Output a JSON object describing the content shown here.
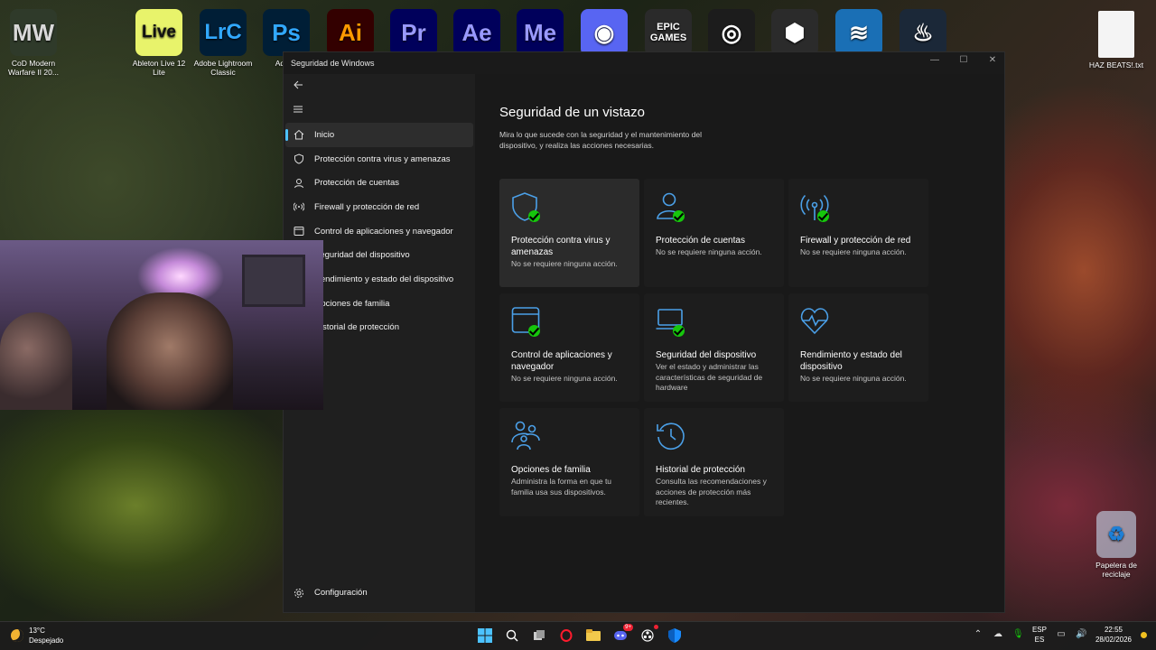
{
  "desktop": {
    "icons": [
      {
        "label": "CoD Modern Warfare II 20...",
        "glyph": "MW",
        "bg": "#2f3a2a",
        "fg": "#d9d9d9"
      },
      {
        "label": "Ableton Live 12 Lite",
        "glyph": "Live",
        "bg": "#e8f36b",
        "fg": "#111111"
      },
      {
        "label": "Adobe Lightroom Classic",
        "glyph": "LrC",
        "bg": "#001e36",
        "fg": "#31a8ff"
      },
      {
        "label": "Adobe",
        "glyph": "Ps",
        "bg": "#001e36",
        "fg": "#31a8ff"
      },
      {
        "label": "",
        "glyph": "Ai",
        "bg": "#330000",
        "fg": "#ff9a00"
      },
      {
        "label": "",
        "glyph": "Pr",
        "bg": "#00005b",
        "fg": "#9999ff"
      },
      {
        "label": "",
        "glyph": "Ae",
        "bg": "#00005b",
        "fg": "#9999ff"
      },
      {
        "label": "",
        "glyph": "Me",
        "bg": "#00005b",
        "fg": "#9999ff"
      },
      {
        "label": "",
        "glyph": "◉",
        "bg": "#5865f2",
        "fg": "#ffffff"
      },
      {
        "label": "",
        "glyph": "EPIC GAMES",
        "bg": "#2a2a2a",
        "fg": "#ffffff"
      },
      {
        "label": "",
        "glyph": "◎",
        "bg": "#1c1c1c",
        "fg": "#ffffff"
      },
      {
        "label": "",
        "glyph": "⬢",
        "bg": "#2b2b2b",
        "fg": "#ffffff"
      },
      {
        "label": "",
        "glyph": "≋",
        "bg": "#1a6fb5",
        "fg": "#ffffff"
      },
      {
        "label": "",
        "glyph": "♨",
        "bg": "#1b2838",
        "fg": "#ffffff"
      }
    ],
    "file_label": "HAZ BEATS!.txt",
    "recycle_label": "Papelera de reciclaje"
  },
  "window": {
    "title": "Seguridad de Windows",
    "controls": [
      "—",
      "☐",
      "✕"
    ],
    "nav": {
      "items": [
        {
          "label": "Inicio",
          "icon": "home-icon"
        },
        {
          "label": "Protección contra virus y amenazas",
          "icon": "shield-icon"
        },
        {
          "label": "Protección de cuentas",
          "icon": "person-icon"
        },
        {
          "label": "Firewall y protección de red",
          "icon": "wifi-icon"
        },
        {
          "label": "Control de aplicaciones y navegador",
          "icon": "browser-icon"
        },
        {
          "label": "Seguridad del dispositivo",
          "icon": "laptop-icon"
        },
        {
          "label": "Rendimiento y estado del dispositivo",
          "icon": "heart-icon"
        },
        {
          "label": "Opciones de familia",
          "icon": "family-icon"
        },
        {
          "label": "Historial de protección",
          "icon": "history-icon"
        }
      ],
      "settings_label": "Configuración"
    },
    "main": {
      "title": "Seguridad de un vistazo",
      "description": "Mira lo que sucede con la seguridad y el mantenimiento del dispositivo, y realiza las acciones necesarias.",
      "tiles": [
        {
          "title": "Protección contra virus y amenazas",
          "subtitle": "No se requiere ninguna acción.",
          "icon": "shield-icon",
          "check": true
        },
        {
          "title": "Protección de cuentas",
          "subtitle": "No se requiere ninguna acción.",
          "icon": "person-icon",
          "check": true
        },
        {
          "title": "Firewall y protección de red",
          "subtitle": "No se requiere ninguna acción.",
          "icon": "wifi-icon",
          "check": true
        },
        {
          "title": "Control de aplicaciones y navegador",
          "subtitle": "No se requiere ninguna acción.",
          "icon": "browser-icon",
          "check": true
        },
        {
          "title": "Seguridad del dispositivo",
          "subtitle": "Ver el estado y administrar las características de seguridad de hardware",
          "icon": "laptop-icon",
          "check": true
        },
        {
          "title": "Rendimiento y estado del dispositivo",
          "subtitle": "No se requiere ninguna acción.",
          "icon": "heart-icon",
          "check": false
        },
        {
          "title": "Opciones de familia",
          "subtitle": "Administra la forma en que tu familia usa sus dispositivos.",
          "icon": "family-icon",
          "check": false
        },
        {
          "title": "Historial de protección",
          "subtitle": "Consulta las recomendaciones y acciones de protección más recientes.",
          "icon": "history-icon",
          "check": false
        }
      ]
    }
  },
  "taskbar": {
    "weather_temp": "13°C",
    "weather_desc": "Despejado",
    "lang_top": "ESP",
    "lang_bottom": "ES",
    "time": "22:55",
    "date": "28/02/2026",
    "discord_badge": "9+"
  },
  "colors": {
    "accent": "#4cc2ff",
    "icon_blue": "#4ba0e8",
    "check_green": "#16c60c"
  }
}
